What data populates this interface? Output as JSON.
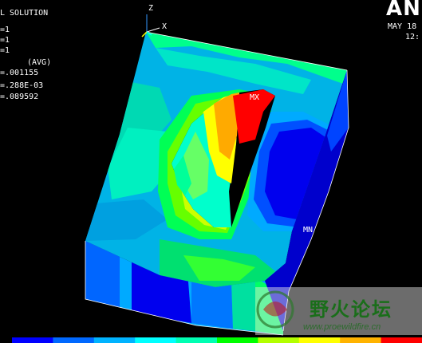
{
  "window": {
    "solution_label": "L SOLUTION",
    "info_lines": [
      "=1",
      "=1",
      "=1"
    ],
    "avg_label": "(AVG)",
    "dmx": "=.001155",
    "smn": "=.288E-03",
    "smx": "=.089592",
    "brand": "ANS",
    "date": "MAY 18",
    "time": "12:"
  },
  "triad": {
    "z_label": "Z",
    "x_label": "X"
  },
  "plot": {
    "max_label": "MX",
    "min_label": "MN"
  },
  "watermark": {
    "text": "野火论坛",
    "url": "www.proewildfire.cn"
  },
  "legend": {
    "colors": [
      "#0000ff",
      "#0068ff",
      "#00b3ff",
      "#00ffff",
      "#00ffb3",
      "#00ff00",
      "#b3ff00",
      "#ffff00",
      "#ffb300",
      "#ff0000"
    ]
  }
}
